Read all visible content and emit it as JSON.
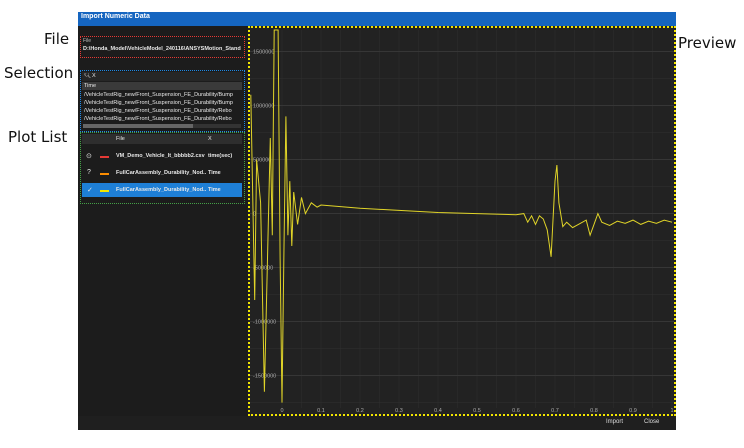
{
  "callouts": {
    "file": "File",
    "selection": "Selection",
    "plot_list": "Plot List",
    "preview": "Preview"
  },
  "window": {
    "title": "Import Numeric Data"
  },
  "file": {
    "label": "File",
    "path": "D:\\Honda_Model\\VehicleModel_240116\\ANSYSMotion_Standar"
  },
  "selection": {
    "search_placeholder": "X",
    "header": "Time",
    "rows": [
      "/VehicleTestRig_new/Front_Suspension_FE_Durability/Bump",
      "/VehicleTestRig_new/Front_Suspension_FE_Durability/Bump",
      "/VehicleTestRig_new/Front_Suspension_FE_Durability/Rebo",
      "/VehicleTestRig_new/Front_Suspension_FE_Durability/Rebo"
    ]
  },
  "plot_list": {
    "headers": {
      "file": "File",
      "x": "X"
    },
    "rows": [
      {
        "status": "⊙",
        "file": "VM_Demo_Vehicle_lt_bbbbb2.csv",
        "x": "time(sec)",
        "color": "#e53935",
        "selected": false
      },
      {
        "status": "?",
        "file": "FullCarAssembly_Durability_Nod...",
        "x": "Time",
        "color": "#fb8c00",
        "selected": false
      },
      {
        "status": "✓",
        "file": "FullCarAssembly_Durability_Nod...",
        "x": "Time",
        "color": "#f2e600",
        "selected": true
      }
    ]
  },
  "buttons": {
    "import": "Import",
    "close": "Close"
  },
  "colors": {
    "accent": "#1565c0",
    "curve": "#e0d428"
  },
  "chart_data": {
    "type": "line",
    "title": "",
    "xlabel": "",
    "ylabel": "",
    "xlim": [
      0,
      1
    ],
    "ylim": [
      -1800000,
      1700000
    ],
    "y_ticks": [
      {
        "v": 1500000,
        "label": "1500000"
      },
      {
        "v": 1000000,
        "label": "1000000"
      },
      {
        "v": 500000,
        "label": "500000"
      },
      {
        "v": 0,
        "label": "0"
      },
      {
        "v": -500000,
        "label": "-500000"
      },
      {
        "v": -1000000,
        "label": "-1000000"
      },
      {
        "v": -1500000,
        "label": "-1500000"
      }
    ],
    "x_ticks": [
      {
        "v": 0,
        "label": "0"
      },
      {
        "v": 0.1,
        "label": "0.1"
      },
      {
        "v": 0.2,
        "label": "0.2"
      },
      {
        "v": 0.3,
        "label": "0.3"
      },
      {
        "v": 0.4,
        "label": "0.4"
      },
      {
        "v": 0.5,
        "label": "0.5"
      },
      {
        "v": 0.6,
        "label": "0.6"
      },
      {
        "v": 0.7,
        "label": "0.7"
      },
      {
        "v": 0.8,
        "label": "0.8"
      },
      {
        "v": 0.9,
        "label": "0.9"
      },
      {
        "v": 1,
        "label": "1"
      }
    ],
    "grid": true,
    "series": [
      {
        "points": [
          [
            -0.08,
            1100000
          ],
          [
            -0.07,
            -800000
          ],
          [
            -0.065,
            500000
          ],
          [
            -0.055,
            100000
          ],
          [
            -0.045,
            -1650000
          ],
          [
            -0.03,
            700000
          ],
          [
            -0.025,
            -200000
          ],
          [
            -0.02,
            1700000
          ],
          [
            -0.01,
            1700000
          ],
          [
            -0.005,
            -400000
          ],
          [
            0,
            -1750000
          ],
          [
            0.005,
            -300000
          ],
          [
            0.01,
            900000
          ],
          [
            0.015,
            -200000
          ],
          [
            0.02,
            300000
          ],
          [
            0.025,
            -300000
          ],
          [
            0.03,
            200000
          ],
          [
            0.04,
            -100000
          ],
          [
            0.05,
            150000
          ],
          [
            0.06,
            0
          ],
          [
            0.075,
            100000
          ],
          [
            0.09,
            60000
          ],
          [
            0.1,
            80000
          ],
          [
            0.2,
            50000
          ],
          [
            0.3,
            30000
          ],
          [
            0.4,
            10000
          ],
          [
            0.5,
            0
          ],
          [
            0.6,
            -10000
          ],
          [
            0.62,
            0
          ],
          [
            0.63,
            -80000
          ],
          [
            0.64,
            -20000
          ],
          [
            0.65,
            -100000
          ],
          [
            0.66,
            -20000
          ],
          [
            0.67,
            -50000
          ],
          [
            0.68,
            -150000
          ],
          [
            0.69,
            -400000
          ],
          [
            0.7,
            300000
          ],
          [
            0.705,
            450000
          ],
          [
            0.71,
            100000
          ],
          [
            0.72,
            -120000
          ],
          [
            0.73,
            -80000
          ],
          [
            0.745,
            -130000
          ],
          [
            0.76,
            -100000
          ],
          [
            0.78,
            -60000
          ],
          [
            0.79,
            -200000
          ],
          [
            0.8,
            -100000
          ],
          [
            0.81,
            0
          ],
          [
            0.82,
            -80000
          ],
          [
            0.84,
            -110000
          ],
          [
            0.86,
            -70000
          ],
          [
            0.88,
            -90000
          ],
          [
            0.9,
            -60000
          ],
          [
            0.92,
            -100000
          ],
          [
            0.94,
            -70000
          ],
          [
            0.96,
            -90000
          ],
          [
            0.98,
            -60000
          ],
          [
            1,
            -80000
          ]
        ]
      }
    ]
  }
}
